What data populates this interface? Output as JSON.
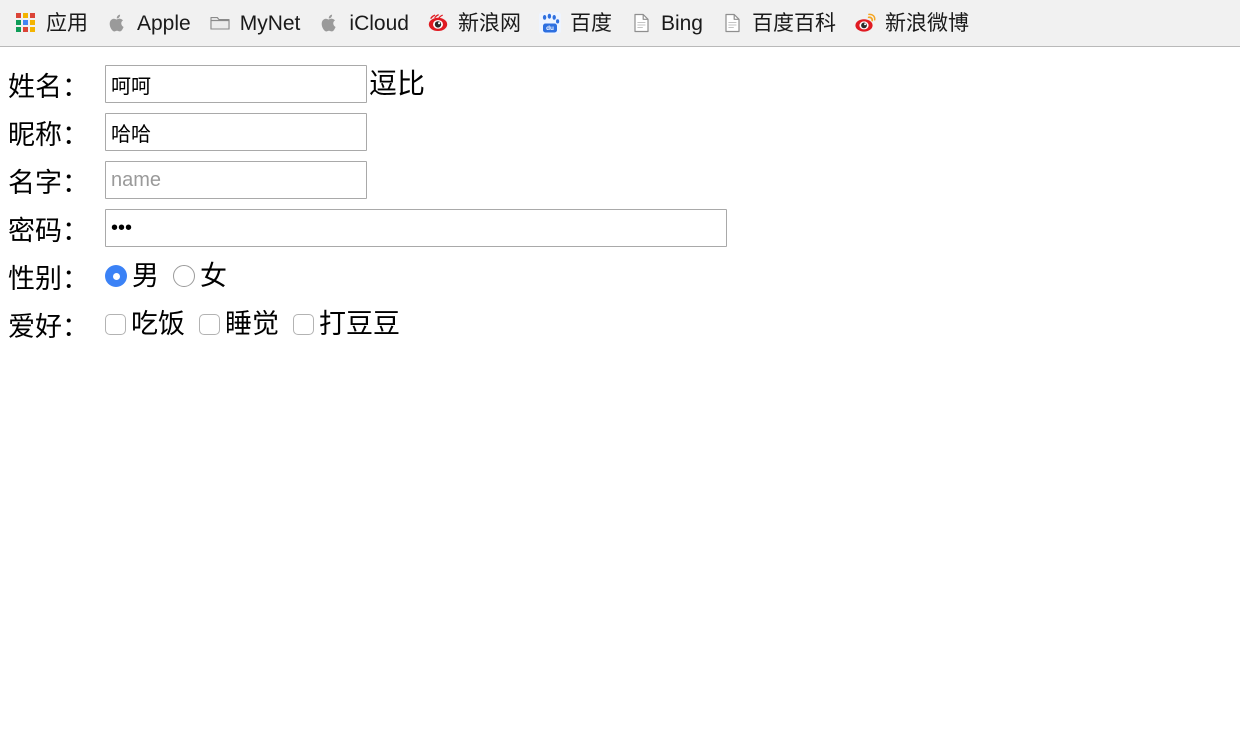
{
  "bookmarks_bar": {
    "items": [
      {
        "label": "应用",
        "icon": "apps-grid-icon"
      },
      {
        "label": "Apple",
        "icon": "apple-logo-icon"
      },
      {
        "label": "MyNet",
        "icon": "folder-icon"
      },
      {
        "label": "iCloud",
        "icon": "apple-logo-icon"
      },
      {
        "label": "新浪网",
        "icon": "sina-eye-icon"
      },
      {
        "label": "百度",
        "icon": "baidu-paw-icon"
      },
      {
        "label": "Bing",
        "icon": "page-document-icon"
      },
      {
        "label": "百度百科",
        "icon": "page-document-icon"
      },
      {
        "label": "新浪微博",
        "icon": "weibo-eye-icon"
      }
    ]
  },
  "form": {
    "rows": {
      "fullname": {
        "label": "姓名：",
        "value": "呵呵",
        "placeholder": "",
        "trailing_text": "逗比"
      },
      "nickname": {
        "label": "昵称：",
        "value": "哈哈",
        "placeholder": ""
      },
      "name": {
        "label": "名字：",
        "value": "",
        "placeholder": "name"
      },
      "password": {
        "label": "密码：",
        "value": "•••",
        "placeholder": ""
      },
      "gender": {
        "label": "性别：",
        "options": [
          {
            "label": "男",
            "checked": true
          },
          {
            "label": "女",
            "checked": false
          }
        ]
      },
      "hobby": {
        "label": "爱好：",
        "options": [
          {
            "label": "吃饭",
            "checked": false
          },
          {
            "label": "睡觉",
            "checked": false
          },
          {
            "label": "打豆豆",
            "checked": false
          }
        ]
      }
    }
  },
  "colors": {
    "radio_checked": "#3b82f6",
    "bar_background": "#f1f1f1",
    "input_border": "#a9a9a9"
  }
}
